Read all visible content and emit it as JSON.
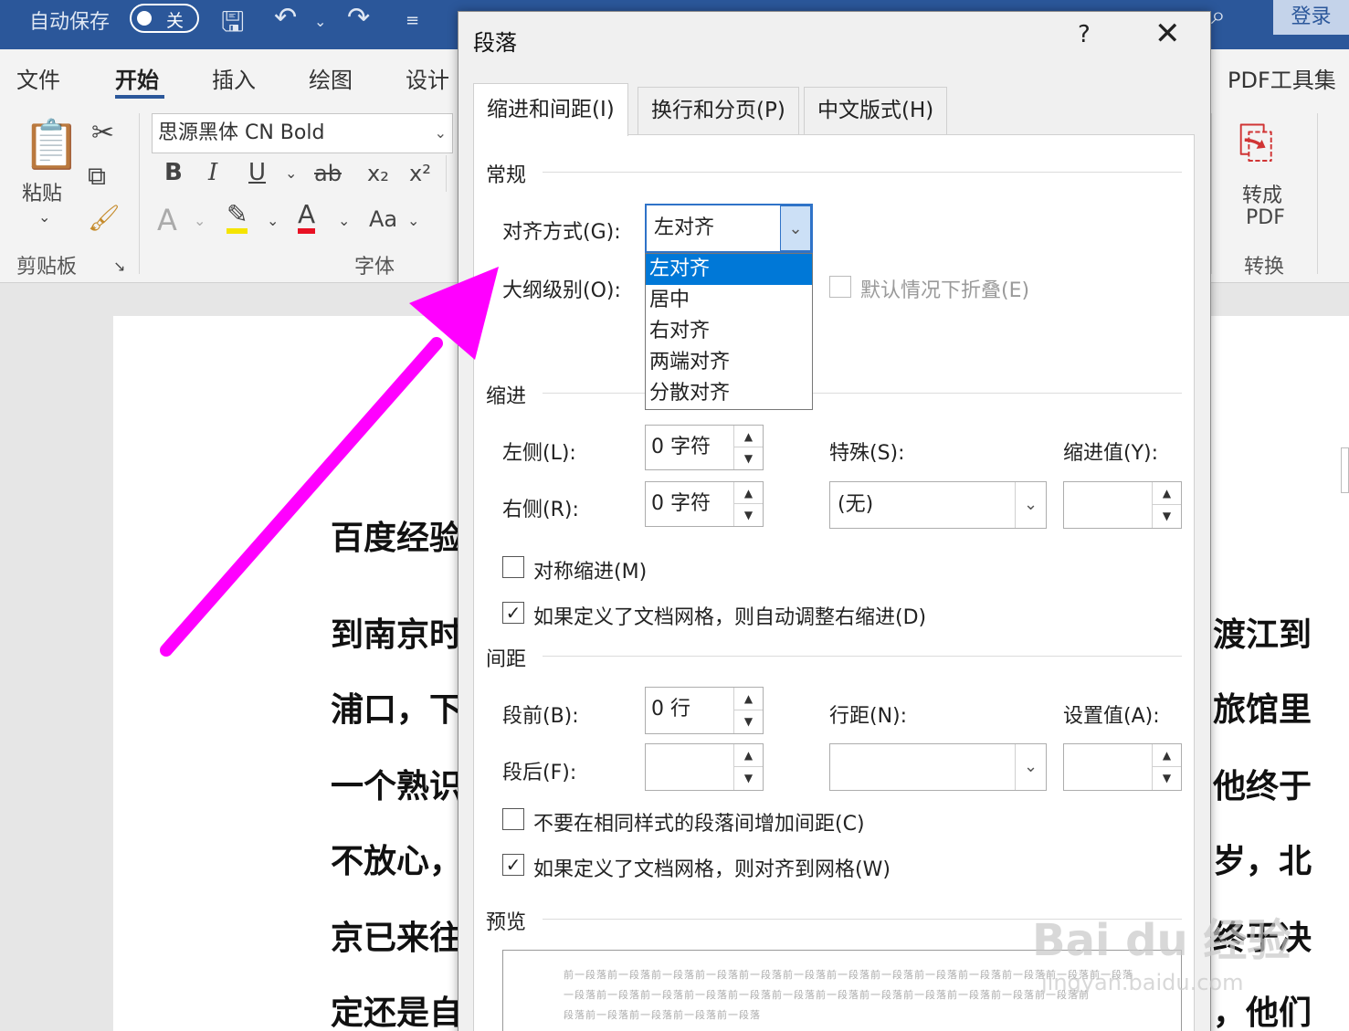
{
  "titlebar": {
    "autosave": "自动保存",
    "toggle_state": "关",
    "login": "登录"
  },
  "ribbon_tabs": [
    "文件",
    "开始",
    "插入",
    "绘图",
    "设计"
  ],
  "ribbon_right_tab": "PDF工具集",
  "clipboard": {
    "paste": "粘贴",
    "group": "剪贴板"
  },
  "font": {
    "name": "思源黑体 CN Bold",
    "group": "字体",
    "aa": "Aa"
  },
  "pdf": {
    "line1": "转成",
    "line2": "PDF",
    "group": "转换"
  },
  "document": {
    "lines_left": [
      "百度经验",
      "到南京时",
      "浦口，下",
      "一个熟识",
      "不放心，",
      "京已来往",
      "定还是自"
    ],
    "lines_right": [
      "渡江到",
      "旅馆里",
      "他终于",
      "岁，北",
      "终于决",
      "，他们"
    ]
  },
  "dialog": {
    "title": "段落",
    "help": "?",
    "close": "✕",
    "tabs": [
      "缩进和间距(I)",
      "换行和分页(P)",
      "中文版式(H)"
    ],
    "general": {
      "section": "常规",
      "alignment_label": "对齐方式(G):",
      "alignment_value": "左对齐",
      "outline_label": "大纲级别(O):",
      "collapse_label": "默认情况下折叠(E)"
    },
    "alignment_options": [
      "左对齐",
      "居中",
      "右对齐",
      "两端对齐",
      "分散对齐"
    ],
    "indent": {
      "section": "缩进",
      "left_label": "左侧(L):",
      "left_value": "0 字符",
      "right_label": "右侧(R):",
      "right_value": "0 字符",
      "special_label": "特殊(S):",
      "special_value": "(无)",
      "indent_value_label": "缩进值(Y):",
      "mirror_label": "对称缩进(M)",
      "auto_adjust_label": "如果定义了文档网格，则自动调整右缩进(D)"
    },
    "spacing": {
      "section": "间距",
      "before_label": "段前(B):",
      "before_value": "0 行",
      "after_label": "段后(F):",
      "line_label": "行距(N):",
      "at_label": "设置值(A):",
      "no_space_label": "不要在相同样式的段落间增加间距(C)",
      "snap_grid_label": "如果定义了文档网格，则对齐到网格(W)"
    },
    "preview": {
      "section": "预览",
      "line1": "前一段落前一段落前一段落前一段落前一段落前一段落前一段落前一段落前一段落前一段落前一段落前一段落前一段落",
      "line2": "一段落前一段落前一段落前一段落前一段落前一段落前一段落前一段落前一段落前一段落前一段落前一段落前",
      "line3": "段落前一段落前一段落前一段落前一段落"
    }
  },
  "watermark": {
    "brand": "Bai du 经验",
    "url": "jingyan.baidu.com"
  },
  "colors": {
    "word_blue": "#2b579a",
    "selection": "#0078d7",
    "arrow": "#ff00ff"
  }
}
